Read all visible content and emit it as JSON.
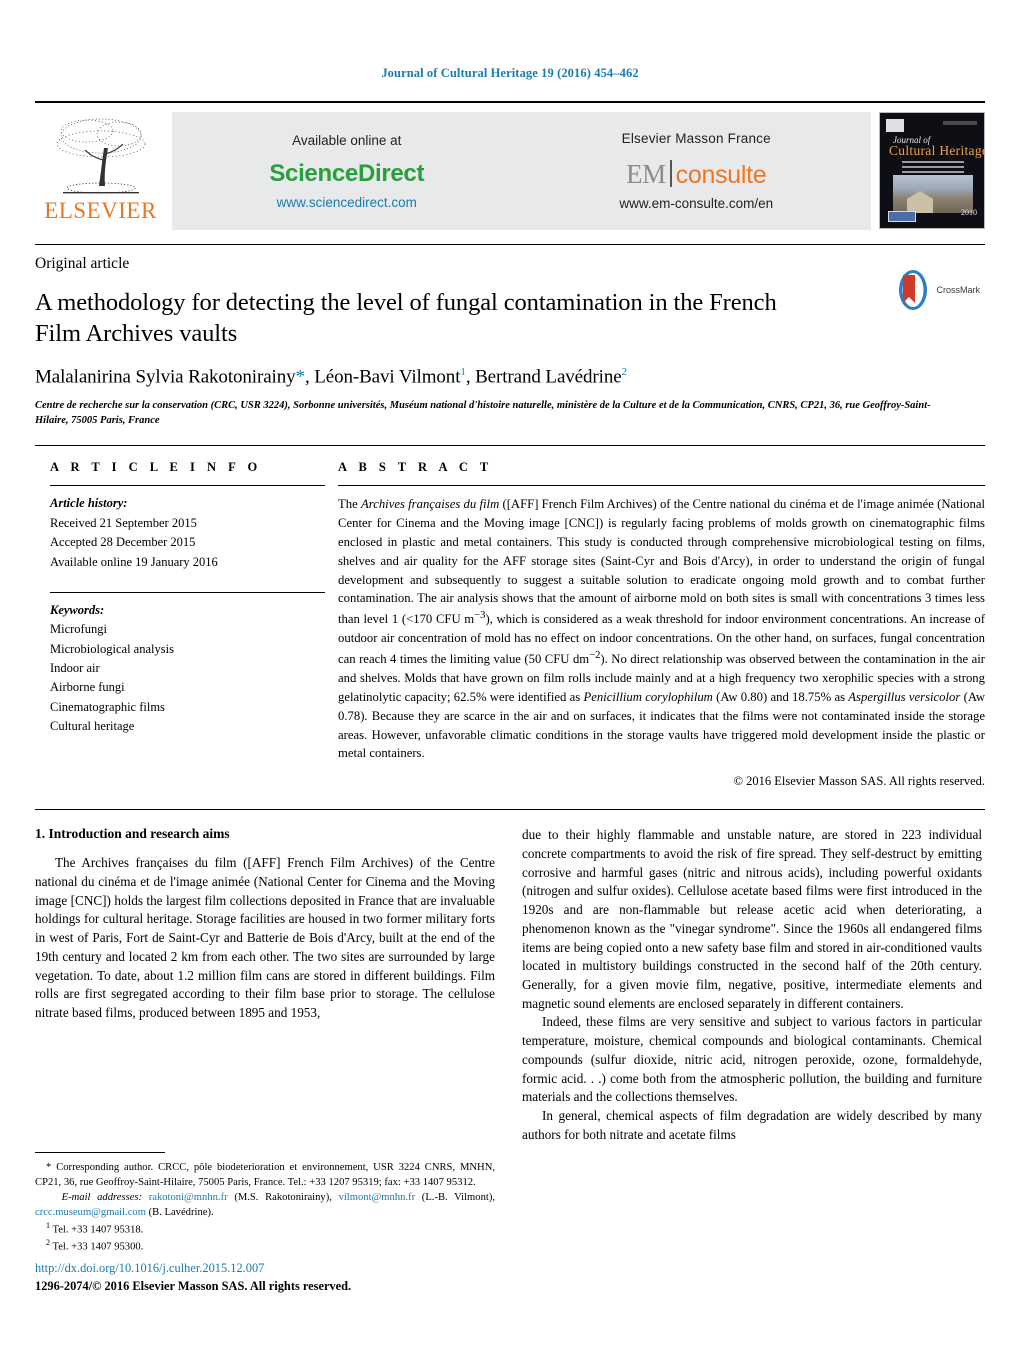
{
  "running_head": "Journal of Cultural Heritage 19 (2016) 454–462",
  "masthead": {
    "elsevier_wordmark": "ELSEVIER",
    "available_online": "Available online at",
    "sciencedirect": "ScienceDirect",
    "sciencedirect_url": "www.sciencedirect.com",
    "em_publisher": "Elsevier Masson France",
    "em_logo_left": "EM",
    "em_logo_right": "consulte",
    "em_url": "www.em-consulte.com/en",
    "cover": {
      "journal_word": "Journal of",
      "title": "Cultural Heritage",
      "year": "2010"
    }
  },
  "article": {
    "type": "Original article",
    "title": "A methodology for detecting the level of fungal contamination in the French Film Archives vaults",
    "crossmark_label": "CrossMark",
    "authors_html": "Malalanirina Sylvia Rakotonirainy<span class=\"star\">*</span>, Léon-Bavi Vilmont<sup>1</sup>, Bertrand Lavédrine<sup>2</sup>",
    "affiliation": "Centre de recherche sur la conservation (CRC, USR 3224), Sorbonne universités, Muséum national d'histoire naturelle, ministère de la Culture et de la Communication, CNRS, CP21, 36, rue Geoffroy-Saint-Hilaire, 75005 Paris, France"
  },
  "info": {
    "heading": "A R T I C L E   I N F O",
    "history_label": "Article history:",
    "history": [
      "Received 21 September 2015",
      "Accepted 28 December 2015",
      "Available online 19 January 2016"
    ],
    "keywords_label": "Keywords:",
    "keywords": [
      "Microfungi",
      "Microbiological analysis",
      "Indoor air",
      "Airborne fungi",
      "Cinematographic films",
      "Cultural heritage"
    ]
  },
  "abstract": {
    "heading": "A B S T R A C T",
    "text_html": "The <i>Archives françaises du film</i> ([AFF] French Film Archives) of the Centre national du cinéma et de l'image animée (National Center for Cinema and the Moving image [CNC]) is regularly facing problems of molds growth on cinematographic films enclosed in plastic and metal containers. This study is conducted through comprehensive microbiological testing on films, shelves and air quality for the AFF storage sites (Saint-Cyr and Bois d'Arcy), in order to understand the origin of fungal development and subsequently to suggest a suitable solution to eradicate ongoing mold growth and to combat further contamination. The air analysis shows that the amount of airborne mold on both sites is small with concentrations 3 times less than level 1 (&lt;170 CFU m<sup>−3</sup>), which is considered as a weak threshold for indoor environment concentrations. An increase of outdoor air concentration of mold has no effect on indoor concentrations. On the other hand, on surfaces, fungal concentration can reach 4 times the limiting value (50 CFU dm<sup>−2</sup>). No direct relationship was observed between the contamination in the air and shelves. Molds that have grown on film rolls include mainly and at a high frequency two xerophilic species with a strong gelatinolytic capacity; 62.5% were identified as <i>Penicillium corylophilum</i> (Aw 0.80) and 18.75% as <i>Aspergillus versicolor</i> (Aw 0.78). Because they are scarce in the air and on surfaces, it indicates that the films were not contaminated inside the storage areas. However, unfavorable climatic conditions in the storage vaults have triggered mold development inside the plastic or metal containers.",
    "copyright": "© 2016 Elsevier Masson SAS. All rights reserved."
  },
  "body": {
    "section_heading": "1. Introduction and research aims",
    "left_paragraphs": [
      "The Archives françaises du film ([AFF] French Film Archives) of the Centre national du cinéma et de l'image animée (National Center for Cinema and the Moving image [CNC]) holds the largest film collections deposited in France that are invaluable holdings for cultural heritage. Storage facilities are housed in two former military forts in west of Paris, Fort de Saint-Cyr and Batterie de Bois d'Arcy, built at the end of the 19th century and located 2 km from each other. The two sites are surrounded by large vegetation. To date, about 1.2 million film cans are stored in different buildings. Film rolls are first segregated according to their film base prior to storage. The cellulose nitrate based films, produced between 1895 and 1953,"
    ],
    "right_paragraphs": [
      "due to their highly flammable and unstable nature, are stored in 223 individual concrete compartments to avoid the risk of fire spread. They self-destruct by emitting corrosive and harmful gases (nitric and nitrous acids), including powerful oxidants (nitrogen and sulfur oxides). Cellulose acetate based films were first introduced in the 1920s and are non-flammable but release acetic acid when deteriorating, a phenomenon known as the \"vinegar syndrome\". Since the 1960s all endangered films items are being copied onto a new safety base film and stored in air-conditioned vaults located in multistory buildings constructed in the second half of the 20th century. Generally, for a given movie film, negative, positive, intermediate elements and magnetic sound elements are enclosed separately in different containers.",
      "Indeed, these films are very sensitive and subject to various factors in particular temperature, moisture, chemical compounds and biological contaminants. Chemical compounds (sulfur dioxide, nitric acid, nitrogen peroxide, ozone, formaldehyde, formic acid. . .) come both from the atmospheric pollution, the building and furniture materials and the collections themselves.",
      "In general, chemical aspects of film degradation are widely described by many authors for both nitrate and acetate films"
    ]
  },
  "footnotes": {
    "corresponding_html": "<span class=\"ind\">* Corresponding author. CRCC, pôle biodeterioration et environnement, USR 3224 CNRS, MNHN, CP21, 36, rue Geoffroy-Saint-Hilaire, 75005 Paris, France. Tel.: +33 1207 95319; fax: +33 1407 95312.</span>",
    "email_label": "E-mail addresses:",
    "emails": [
      {
        "address": "rakotoni@mnhn.fr",
        "owner": "(M.S. Rakotonirainy)"
      },
      {
        "address": "vilmont@mnhn.fr",
        "owner": "(L.-B. Vilmont)"
      },
      {
        "address": "crcc.museum@gmail.com",
        "owner": "(B. Lavédrine)"
      }
    ],
    "notes": [
      {
        "marker": "1",
        "text": "Tel. +33 1407 95318."
      },
      {
        "marker": "2",
        "text": "Tel. +33 1407 95300."
      }
    ]
  },
  "footer": {
    "doi": "http://dx.doi.org/10.1016/j.culher.2015.12.007",
    "issn_line": "1296-2074/© 2016 Elsevier Masson SAS. All rights reserved."
  },
  "colors": {
    "link_blue": "#1a7bb0",
    "elsevier_orange": "#E87722",
    "sciencedirect_green": "#27a03c",
    "em_orange": "#ef7622",
    "banner_gray": "#e8e9ea"
  }
}
